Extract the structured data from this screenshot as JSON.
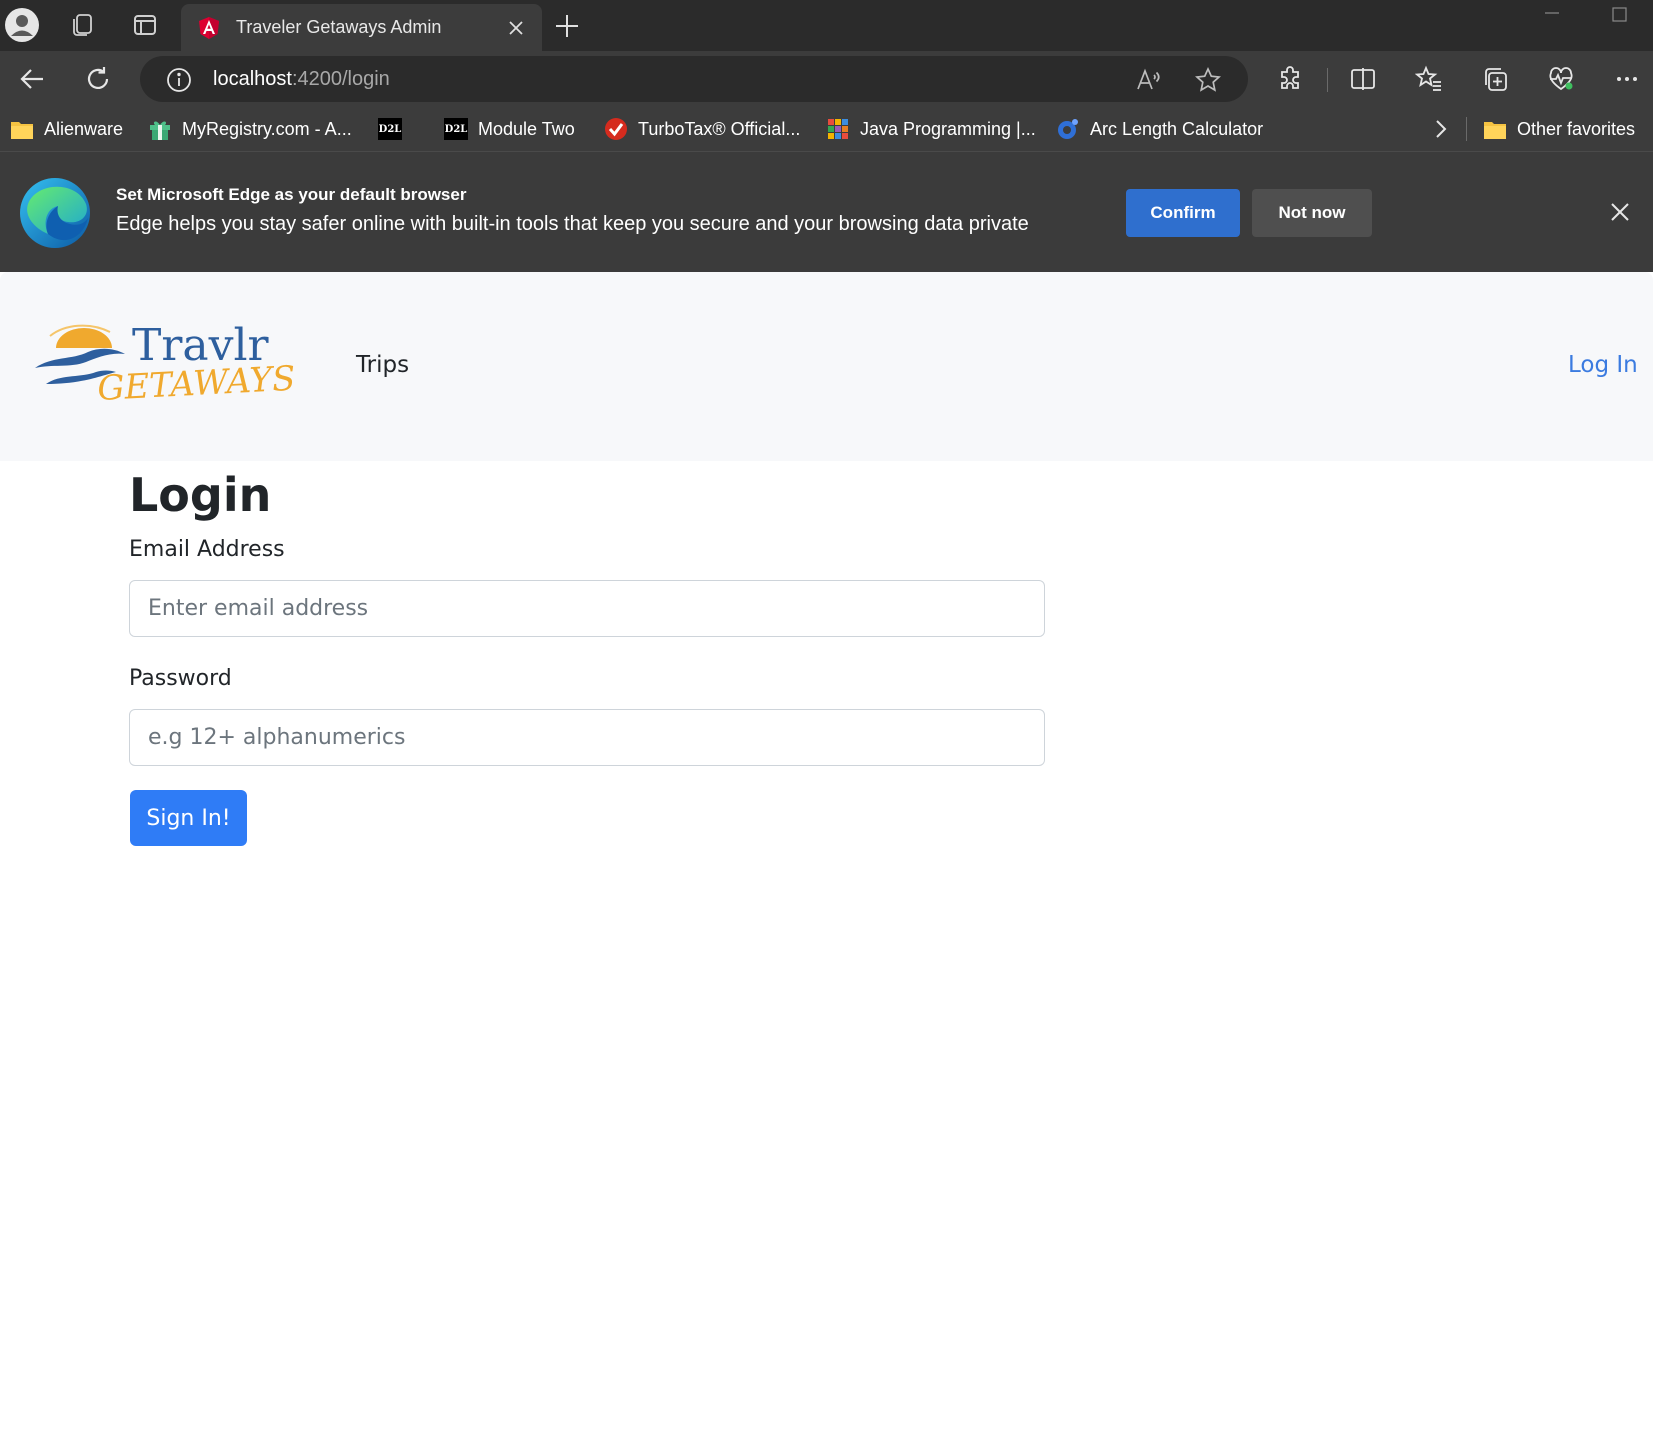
{
  "browser": {
    "tab": {
      "title": "Traveler Getaways Admin"
    },
    "address_bar": {
      "host": "localhost",
      "path": ":4200/login"
    },
    "favorites": [
      {
        "label": "Alienware",
        "icon": "folder-icon"
      },
      {
        "label": "MyRegistry.com - A...",
        "icon": "gift-icon"
      },
      {
        "label": "",
        "icon": "d2l-icon",
        "badge": "D2L"
      },
      {
        "label": "Module Two",
        "icon": "d2l-icon",
        "badge": "D2L"
      },
      {
        "label": "TurboTax® Official...",
        "icon": "turbotax-icon"
      },
      {
        "label": "Java Programming |...",
        "icon": "java-icon"
      },
      {
        "label": "Arc Length Calculator",
        "icon": "calculator-icon"
      }
    ],
    "other_favorites": "Other favorites"
  },
  "banner": {
    "title": "Set Microsoft Edge as your default browser",
    "text": "Edge helps you stay safer online with built-in tools that keep you secure and your browsing data private",
    "confirm": "Confirm",
    "not_now": "Not now"
  },
  "site": {
    "logo": {
      "line1": "Travlr",
      "line2": "GETAWAYS"
    },
    "nav": {
      "trips": "Trips",
      "login": "Log In"
    }
  },
  "login_form": {
    "heading": "Login",
    "email_label": "Email Address",
    "email_placeholder": "Enter email address",
    "email_value": "",
    "password_label": "Password",
    "password_placeholder": "e.g 12+ alphanumerics",
    "password_value": "",
    "submit": "Sign In!"
  },
  "colors": {
    "chrome_dark": "#2b2b2b",
    "chrome_mid": "#3c3c3c",
    "confirm_blue": "#2f6fce",
    "link_blue": "#3b7be0",
    "primary_button": "#2f7cf6",
    "logo_blue": "#2e5f9e",
    "logo_orange": "#f0a92e"
  }
}
